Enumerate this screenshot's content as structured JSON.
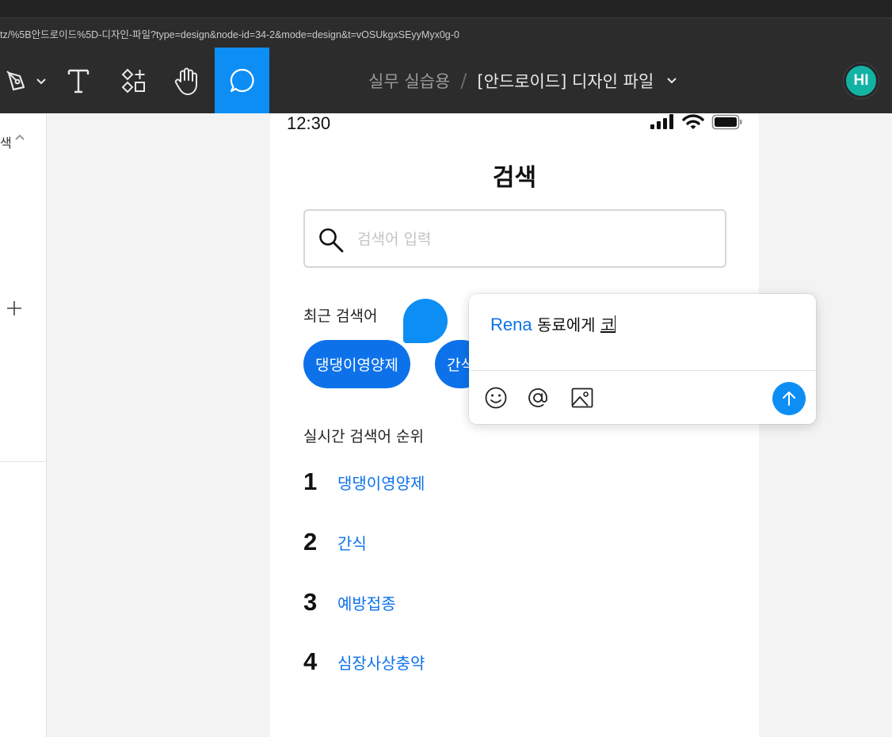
{
  "browser": {
    "url": "tz/%5B안드로이드%5D-디자인-파일?type=design&node-id=34-2&mode=design&t=vOSUkgxSEyyMyx0g-0"
  },
  "toolbar": {
    "tools": [
      {
        "icon": "pen-icon",
        "has_dropdown": true
      },
      {
        "icon": "text-icon"
      },
      {
        "icon": "components-icon"
      },
      {
        "icon": "hand-icon"
      },
      {
        "icon": "comment-icon",
        "active": true
      }
    ],
    "project": "실무 실습용",
    "separator": "/",
    "file_name": "[안드로이드] 디자인 파일",
    "avatar_initials": "HI",
    "avatar_color": "#13b3a4",
    "accent_color": "#0d8ef5"
  },
  "left_panel": {
    "fragment": "색"
  },
  "phone": {
    "status_time": "12:30",
    "title": "검색",
    "search_placeholder": "검색어 입력",
    "recent_label": "최근 검색어",
    "recent_chips": [
      "댕댕이영양제",
      "간식"
    ],
    "realtime_label": "실시간 검색어 순위",
    "ranking": [
      {
        "rank": "1",
        "word": "댕댕이영양제"
      },
      {
        "rank": "2",
        "word": "간식"
      },
      {
        "rank": "3",
        "word": "예방접종"
      },
      {
        "rank": "4",
        "word": "심장사상충약"
      }
    ],
    "link_color": "#0d72ea"
  },
  "comment": {
    "mention": "Rena",
    "text": " 동료에게 ",
    "typed": "코"
  }
}
